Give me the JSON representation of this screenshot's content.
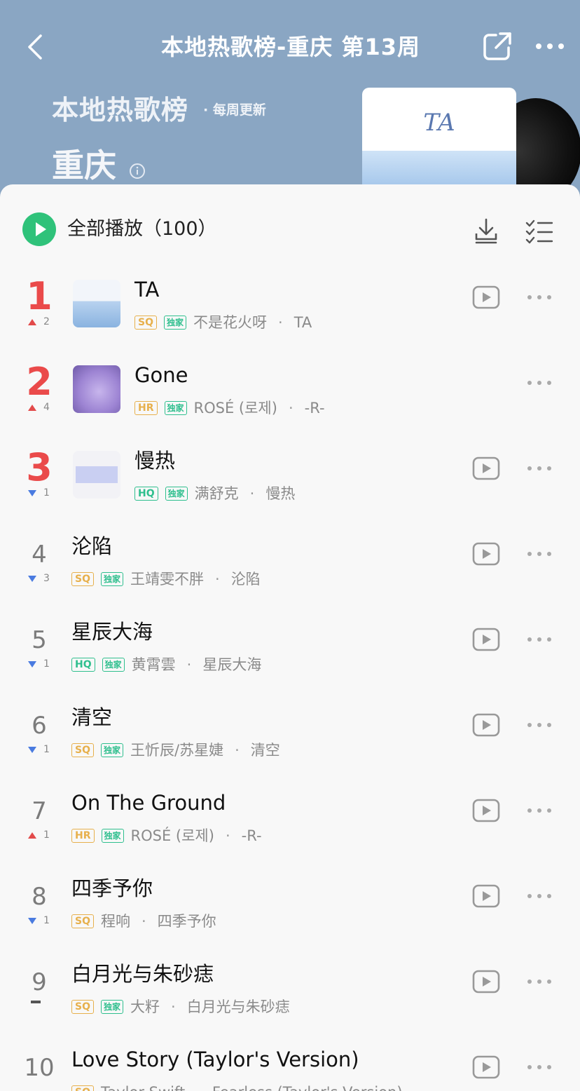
{
  "header": {
    "title": "本地热歌榜-重庆 第13周",
    "banner_title": "本地热歌榜",
    "banner_sub": "· 每周更新",
    "city": "重庆",
    "cover_text": "TA"
  },
  "playall": {
    "label": "全部播放（100）"
  },
  "colors": {
    "accent": "#2fc27a",
    "rank_top": "#ea4a4a",
    "header_bg": "#8aa6c3"
  },
  "songs": [
    {
      "rank": "1",
      "trend": "2",
      "trend_dir": "up",
      "title": "TA",
      "quality": "SQ",
      "exclusive": "独家",
      "artist": "不是花火呀",
      "album": "TA",
      "has_mv": true
    },
    {
      "rank": "2",
      "trend": "4",
      "trend_dir": "up",
      "title": "Gone",
      "quality": "HR",
      "exclusive": "独家",
      "artist": "ROSÉ (로제)",
      "album": "-R-",
      "has_mv": false
    },
    {
      "rank": "3",
      "trend": "1",
      "trend_dir": "down",
      "title": "慢热",
      "quality": "HQ",
      "exclusive": "独家",
      "artist": "满舒克",
      "album": "慢热",
      "has_mv": true
    },
    {
      "rank": "4",
      "trend": "3",
      "trend_dir": "down",
      "title": "沦陷",
      "quality": "SQ",
      "exclusive": "独家",
      "artist": "王靖雯不胖",
      "album": "沦陷",
      "has_mv": true
    },
    {
      "rank": "5",
      "trend": "1",
      "trend_dir": "down",
      "title": "星辰大海",
      "quality": "HQ",
      "exclusive": "独家",
      "artist": "黄霄雲",
      "album": "星辰大海",
      "has_mv": true
    },
    {
      "rank": "6",
      "trend": "1",
      "trend_dir": "down",
      "title": "清空",
      "quality": "SQ",
      "exclusive": "独家",
      "artist": "王忻辰/苏星婕",
      "album": "清空",
      "has_mv": true
    },
    {
      "rank": "7",
      "trend": "1",
      "trend_dir": "up",
      "title": "On The Ground",
      "quality": "HR",
      "exclusive": "独家",
      "artist": "ROSÉ (로제)",
      "album": "-R-",
      "has_mv": true
    },
    {
      "rank": "8",
      "trend": "1",
      "trend_dir": "down",
      "title": "四季予你",
      "quality": "SQ",
      "exclusive": "",
      "artist": "程响",
      "album": "四季予你",
      "has_mv": true
    },
    {
      "rank": "9",
      "trend": "",
      "trend_dir": "flat",
      "title": "白月光与朱砂痣",
      "quality": "SQ",
      "exclusive": "独家",
      "artist": "大籽",
      "album": "白月光与朱砂痣",
      "has_mv": true
    },
    {
      "rank": "10",
      "trend": "",
      "trend_dir": "none",
      "title": "Love Story (Taylor's Version)",
      "quality": "SQ",
      "exclusive": "",
      "artist": "Taylor Swift",
      "album": "Fearless (Taylor's Version)",
      "has_mv": true
    }
  ]
}
